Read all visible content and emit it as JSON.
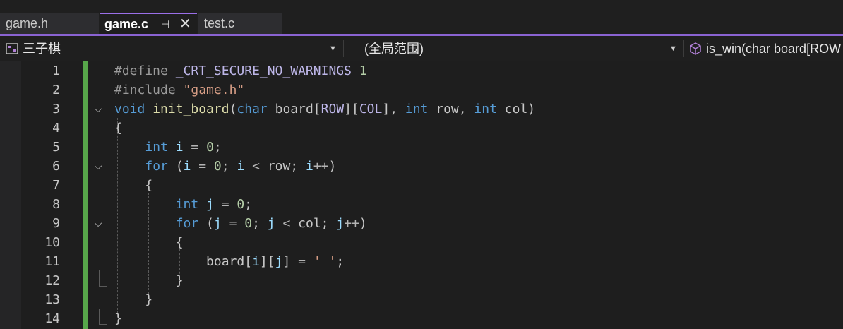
{
  "tabs": [
    {
      "label": "game.h",
      "active": false
    },
    {
      "label": "game.c",
      "active": true,
      "pin_glyph": "⊣",
      "close_glyph": "✕"
    },
    {
      "label": "test.c",
      "active": false
    }
  ],
  "nav": {
    "project": "三子棋",
    "scope": "(全局范围)",
    "member": "is_win(char board[ROW"
  },
  "editor": {
    "line_numbers": [
      "1",
      "2",
      "3",
      "4",
      "5",
      "6",
      "7",
      "8",
      "9",
      "10",
      "11",
      "12",
      "13",
      "14"
    ],
    "fold_glyph": "⌄",
    "lines": [
      {
        "tokens": [
          [
            "pp",
            "#define "
          ],
          [
            "mac",
            "_CRT_SECURE_NO_WARNINGS"
          ],
          [
            "br",
            " "
          ],
          [
            "num",
            "1"
          ]
        ]
      },
      {
        "tokens": [
          [
            "pp",
            "#include "
          ],
          [
            "str",
            "\"game.h\""
          ]
        ]
      },
      {
        "tokens": [
          [
            "kw",
            "void"
          ],
          [
            "br",
            " "
          ],
          [
            "fn",
            "init_board"
          ],
          [
            "br",
            "("
          ],
          [
            "kw",
            "char"
          ],
          [
            "br",
            " board["
          ],
          [
            "mac",
            "ROW"
          ],
          [
            "br",
            "]["
          ],
          [
            "mac",
            "COL"
          ],
          [
            "br",
            "], "
          ],
          [
            "kw",
            "int"
          ],
          [
            "br",
            " row, "
          ],
          [
            "kw",
            "int"
          ],
          [
            "br",
            " col)"
          ]
        ]
      },
      {
        "tokens": [
          [
            "br",
            "{"
          ]
        ]
      },
      {
        "tokens": [
          [
            "br",
            "    "
          ],
          [
            "kw",
            "int"
          ],
          [
            "br",
            " "
          ],
          [
            "id",
            "i"
          ],
          [
            "op",
            " = "
          ],
          [
            "num",
            "0"
          ],
          [
            "br",
            ";"
          ]
        ]
      },
      {
        "tokens": [
          [
            "br",
            "    "
          ],
          [
            "kw",
            "for"
          ],
          [
            "br",
            " ("
          ],
          [
            "id",
            "i"
          ],
          [
            "op",
            " = "
          ],
          [
            "num",
            "0"
          ],
          [
            "br",
            "; "
          ],
          [
            "id",
            "i"
          ],
          [
            "op",
            " < "
          ],
          [
            "br",
            "row; "
          ],
          [
            "id",
            "i"
          ],
          [
            "op",
            "++"
          ],
          [
            "br",
            ")"
          ]
        ]
      },
      {
        "tokens": [
          [
            "br",
            "    {"
          ]
        ]
      },
      {
        "tokens": [
          [
            "br",
            "        "
          ],
          [
            "kw",
            "int"
          ],
          [
            "br",
            " "
          ],
          [
            "id",
            "j"
          ],
          [
            "op",
            " = "
          ],
          [
            "num",
            "0"
          ],
          [
            "br",
            ";"
          ]
        ]
      },
      {
        "tokens": [
          [
            "br",
            "        "
          ],
          [
            "kw",
            "for"
          ],
          [
            "br",
            " ("
          ],
          [
            "id",
            "j"
          ],
          [
            "op",
            " = "
          ],
          [
            "num",
            "0"
          ],
          [
            "br",
            "; "
          ],
          [
            "id",
            "j"
          ],
          [
            "op",
            " < "
          ],
          [
            "br",
            "col; "
          ],
          [
            "id",
            "j"
          ],
          [
            "op",
            "++"
          ],
          [
            "br",
            ")"
          ]
        ]
      },
      {
        "tokens": [
          [
            "br",
            "        {"
          ]
        ]
      },
      {
        "tokens": [
          [
            "br",
            "            board["
          ],
          [
            "id",
            "i"
          ],
          [
            "br",
            "]["
          ],
          [
            "id",
            "j"
          ],
          [
            "br",
            "]"
          ],
          [
            "op",
            " = "
          ],
          [
            "str",
            "' '"
          ],
          [
            "br",
            ";"
          ]
        ]
      },
      {
        "tokens": [
          [
            "br",
            "        }"
          ]
        ]
      },
      {
        "tokens": [
          [
            "br",
            "    }"
          ]
        ]
      },
      {
        "tokens": [
          [
            "br",
            "}"
          ]
        ]
      }
    ],
    "folded_lines": [
      3,
      6,
      9
    ]
  }
}
